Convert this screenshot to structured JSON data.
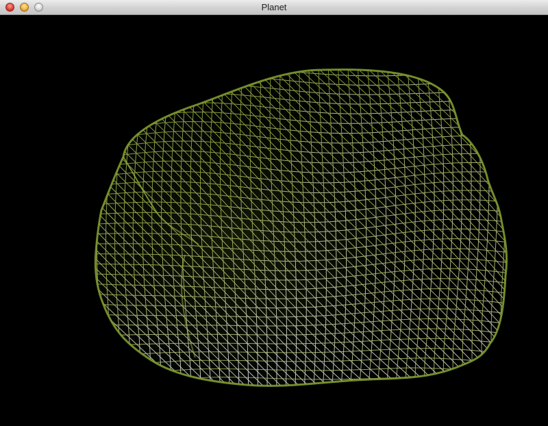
{
  "window": {
    "title": "Planet"
  },
  "controls": {
    "close_icon": "close-icon",
    "minimize_icon": "minimize-icon",
    "zoom_icon": "zoom-icon"
  },
  "scene": {
    "background_color": "#000000",
    "mesh_color_primary": "#8faa3a",
    "mesh_color_secondary": "#c9d3e6"
  }
}
